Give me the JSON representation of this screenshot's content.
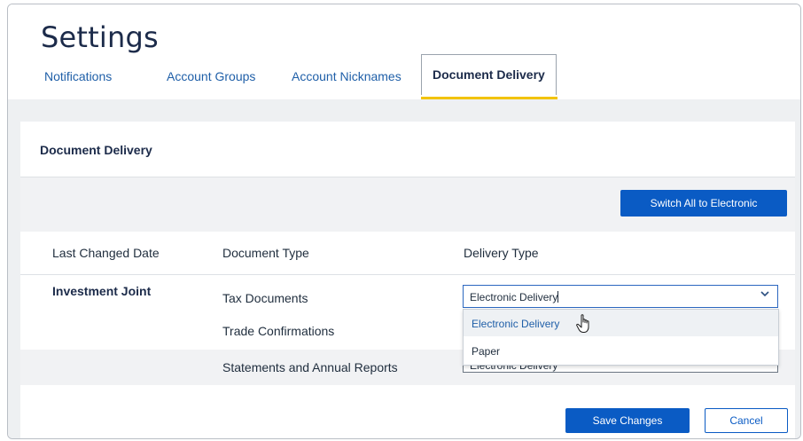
{
  "page": {
    "title": "Settings"
  },
  "tabs": [
    {
      "label": "Notifications"
    },
    {
      "label": "Account Groups"
    },
    {
      "label": "Account Nicknames"
    },
    {
      "label": "Document Delivery",
      "active": true
    }
  ],
  "section": {
    "title": "Document Delivery"
  },
  "actions": {
    "switch_all_label": "Switch All to Electronic"
  },
  "table": {
    "headers": [
      "Last Changed Date",
      "Document Type",
      "Delivery Type"
    ],
    "account_name": "Investment Joint",
    "rows": [
      {
        "document_type": "Tax Documents",
        "delivery": "Electronic Delivery"
      },
      {
        "document_type": "Trade Confirmations",
        "delivery": ""
      },
      {
        "document_type": "Statements and Annual Reports",
        "delivery": "Electronic Delivery"
      }
    ]
  },
  "dropdown": {
    "options": [
      "Electronic Delivery",
      "Paper"
    ],
    "highlighted_index": 0
  },
  "footer": {
    "save_label": "Save Changes",
    "cancel_label": "Cancel"
  },
  "icons": {
    "caret": "chevron-down-icon",
    "cursor": "hand-pointer-icon"
  },
  "colors": {
    "accent": "#0a5bc4",
    "tab_indicator": "#f2c300",
    "link": "#1f5fa8"
  }
}
